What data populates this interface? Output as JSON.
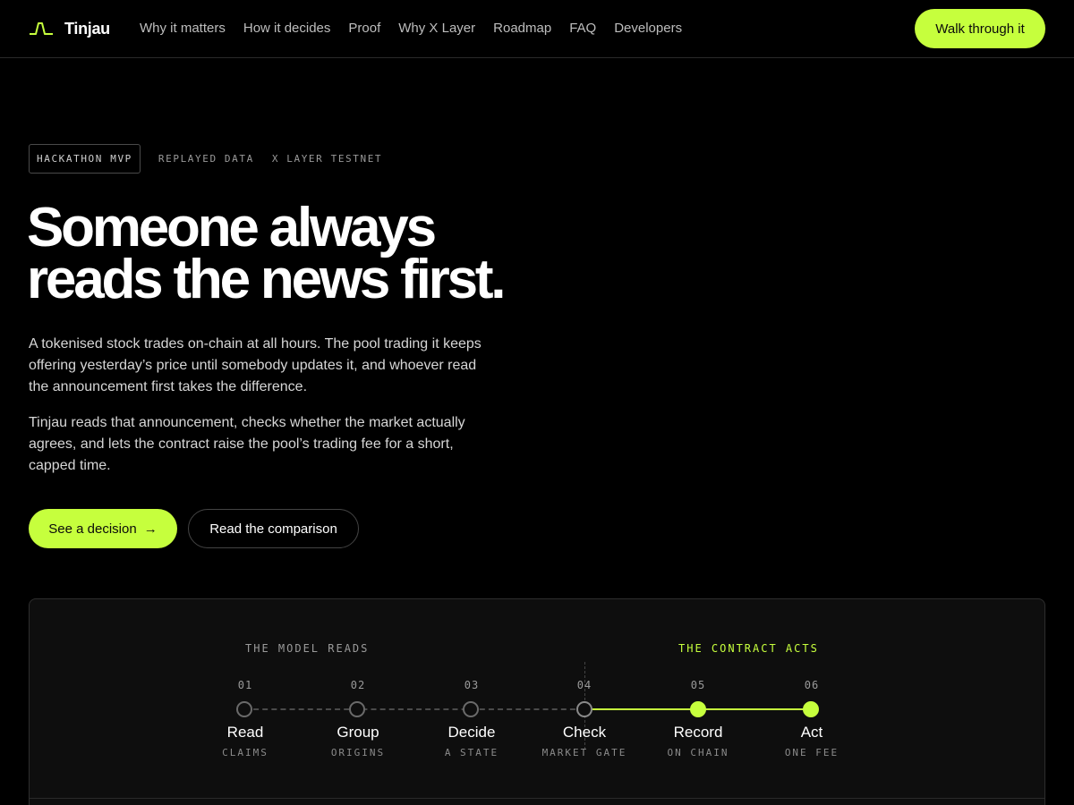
{
  "nav": {
    "brand": "Tinjau",
    "links": [
      "Why it matters",
      "How it decides",
      "Proof",
      "Why X Layer",
      "Roadmap",
      "FAQ",
      "Developers"
    ],
    "cta": "Walk through it"
  },
  "hero": {
    "tags": [
      "HACKATHON MVP",
      "REPLAYED DATA",
      "X LAYER TESTNET"
    ],
    "headline_line1": "Someone always",
    "headline_line2": "reads the news first.",
    "para1": "A tokenised stock trades on-chain at all hours. The pool trading it keeps offering yesterday’s price until somebody updates it, and whoever read the announcement first takes the difference.",
    "para2": "Tinjau reads that announcement, checks whether the market actually agrees, and lets the contract raise the pool’s trading fee for a short, capped time.",
    "primary_cta": "See a decision",
    "primary_arrow": "→",
    "secondary_cta": "Read the comparison"
  },
  "pipeline": {
    "left_label": "THE MODEL READS",
    "right_label": "THE CONTRACT ACTS",
    "accent": "#c6ff3d",
    "steps": [
      {
        "num": "01",
        "title": "Read",
        "sub": "CLAIMS"
      },
      {
        "num": "02",
        "title": "Group",
        "sub": "ORIGINS"
      },
      {
        "num": "03",
        "title": "Decide",
        "sub": "A STATE"
      },
      {
        "num": "04",
        "title": "Check",
        "sub": "MARKET GATE"
      },
      {
        "num": "05",
        "title": "Record",
        "sub": "ON CHAIN"
      },
      {
        "num": "06",
        "title": "Act",
        "sub": "ONE FEE"
      }
    ]
  }
}
